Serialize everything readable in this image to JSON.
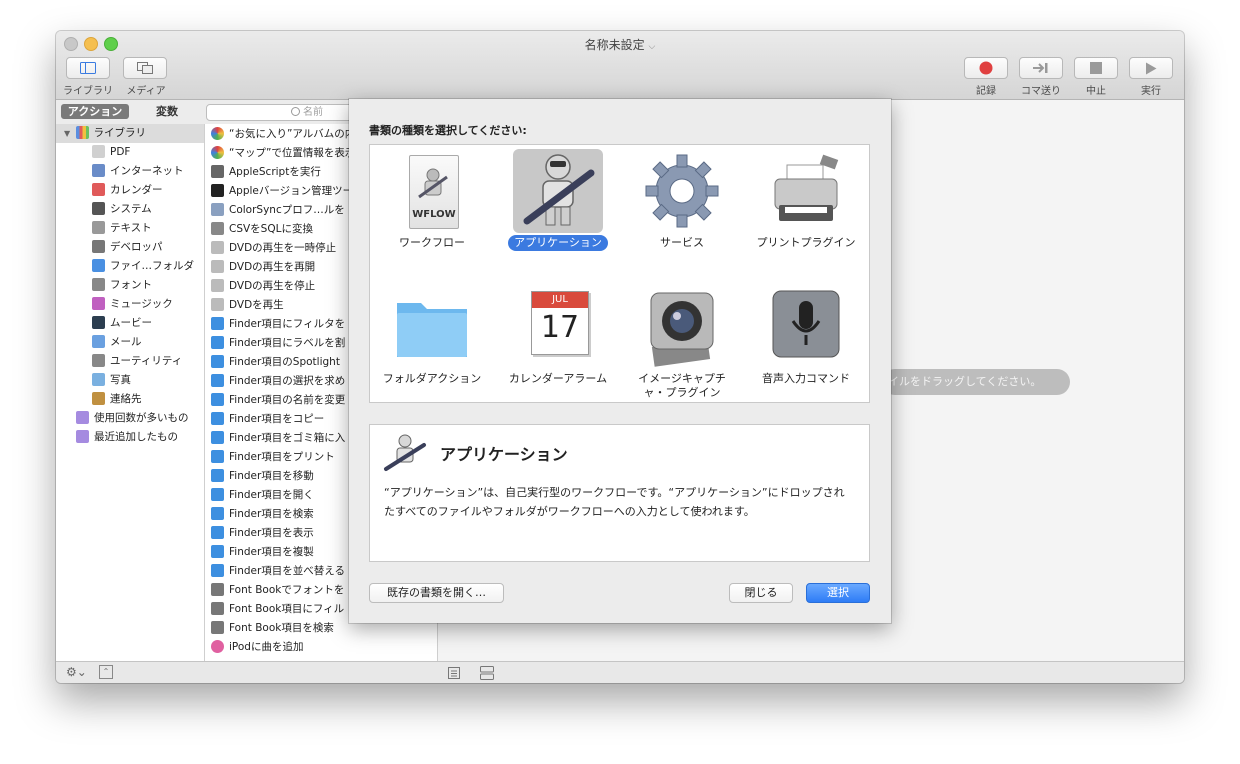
{
  "window": {
    "title": "名称未設定",
    "title_chevron": "⌵"
  },
  "toolbar": {
    "library_label": "ライブラリ",
    "media_label": "メディア",
    "record_label": "記録",
    "step_label": "コマ送り",
    "stop_label": "中止",
    "run_label": "実行"
  },
  "tabs": {
    "actions": "アクション",
    "variables": "変数"
  },
  "search": {
    "placeholder": "名前"
  },
  "library": {
    "root": "ライブラリ",
    "items": [
      "PDF",
      "インターネット",
      "カレンダー",
      "システム",
      "テキスト",
      "デベロッパ",
      "ファイ…フォルダ",
      "フォント",
      "ミュージック",
      "ムービー",
      "メール",
      "ユーティリティ",
      "写真",
      "連絡先"
    ],
    "smart": [
      "使用回数が多いもの",
      "最近追加したもの"
    ]
  },
  "actions": [
    "“お気に入り”アルバムの内",
    "“マップ”で位置情報を表示",
    "AppleScriptを実行",
    "Appleバージョン管理ツー",
    "ColorSyncプロフ…ルを",
    "CSVをSQLに変換",
    "DVDの再生を一時停止",
    "DVDの再生を再開",
    "DVDの再生を停止",
    "DVDを再生",
    "Finder項目にフィルタを",
    "Finder項目にラベルを割",
    "Finder項目のSpotlight",
    "Finder項目の選択を求め",
    "Finder項目の名前を変更",
    "Finder項目をコピー",
    "Finder項目をゴミ箱に入",
    "Finder項目をプリント",
    "Finder項目を移動",
    "Finder項目を開く",
    "Finder項目を検索",
    "Finder項目を表示",
    "Finder項目を複製",
    "Finder項目を並べ替える",
    "Font Bookでフォントを",
    "Font Book項目にフィル",
    "Font Book項目を検索",
    "iPodに曲を追加"
  ],
  "workflow_hint": "イルをドラッグしてください。",
  "sheet": {
    "prompt": "書類の種類を選択してください:",
    "types": [
      {
        "label": "ワークフロー",
        "icon_text": "WFLOW"
      },
      {
        "label": "アプリケーション"
      },
      {
        "label": "サービス"
      },
      {
        "label": "プリントプラグイン"
      },
      {
        "label": "フォルダアクション"
      },
      {
        "label": "カレンダーアラーム",
        "cal_month": "JUL",
        "cal_day": "17"
      },
      {
        "label_line1": "イメージキャプチ",
        "label_line2": "ャ・プラグイン"
      },
      {
        "label": "音声入力コマンド"
      }
    ],
    "selected": "アプリケーション",
    "description_title": "アプリケーション",
    "description": "“アプリケーション”は、自己実行型のワークフローです。“アプリケーション”にドロップされたすべてのファイルやフォルダがワークフローへの入力として使われます。",
    "open_button": "既存の書類を開く…",
    "close_button": "閉じる",
    "choose_button": "選択"
  },
  "colors": {
    "accent": "#3b7ae0",
    "record_red": "#e04040"
  }
}
